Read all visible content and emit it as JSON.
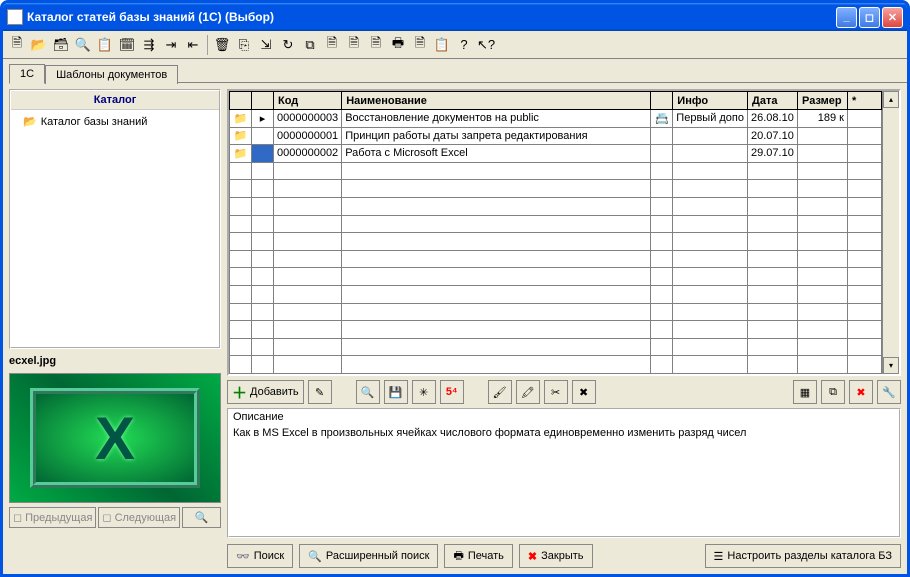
{
  "window": {
    "title": "Каталог статей базы знаний (1С) (Выбор)"
  },
  "tabs": [
    "1С",
    "Шаблоны документов"
  ],
  "active_tab": 0,
  "catalog": {
    "header": "Каталог",
    "root": "Каталог базы знаний"
  },
  "thumbnail": {
    "filename": "ecxel.jpg"
  },
  "left_nav": {
    "prev": "Предыдущая",
    "next": "Следующая"
  },
  "grid": {
    "columns": [
      "",
      "",
      "Код",
      "Наименование",
      "",
      "Инфо",
      "Дата",
      "Размер",
      "*"
    ],
    "rows": [
      {
        "code": "0000000003",
        "name": "Восстановление документов на public",
        "flag": true,
        "info": "Первый допо",
        "date": "26.08.10",
        "size": "189 к",
        "star": ""
      },
      {
        "code": "0000000001",
        "name": "Принцип работы даты запрета редактирования",
        "flag": false,
        "info": "",
        "date": "20.07.10",
        "size": "",
        "star": ""
      },
      {
        "code": "0000000002",
        "name": "Работа с Microsoft Excel",
        "flag": false,
        "info": "",
        "date": "29.07.10",
        "size": "",
        "star": ""
      }
    ],
    "selected_row_index": 2
  },
  "mid_toolbar": {
    "add": "Добавить"
  },
  "description": {
    "label": "Описание",
    "text": "Как в MS Excel в произвольных ячейках числового формата единовременно изменить разряд чисел"
  },
  "bottom": {
    "search": "Поиск",
    "adv_search": "Расширенный поиск",
    "print": "Печать",
    "close": "Закрыть",
    "config": "Настроить разделы каталога БЗ"
  },
  "icons": {
    "folder": "📁",
    "doc": "🗎",
    "search": "🔍",
    "save": "💾",
    "new": "✳",
    "num": "5⁴",
    "brush1": "🖌",
    "brush2": "🖍",
    "brush3": "✂",
    "brush4": "✖",
    "grid": "▦",
    "copy": "⧉",
    "cut": "✄",
    "tool": "🔧",
    "binoc": "👁",
    "printer": "🖶",
    "x": "✖",
    "list": "☰",
    "pencil": "✎"
  }
}
